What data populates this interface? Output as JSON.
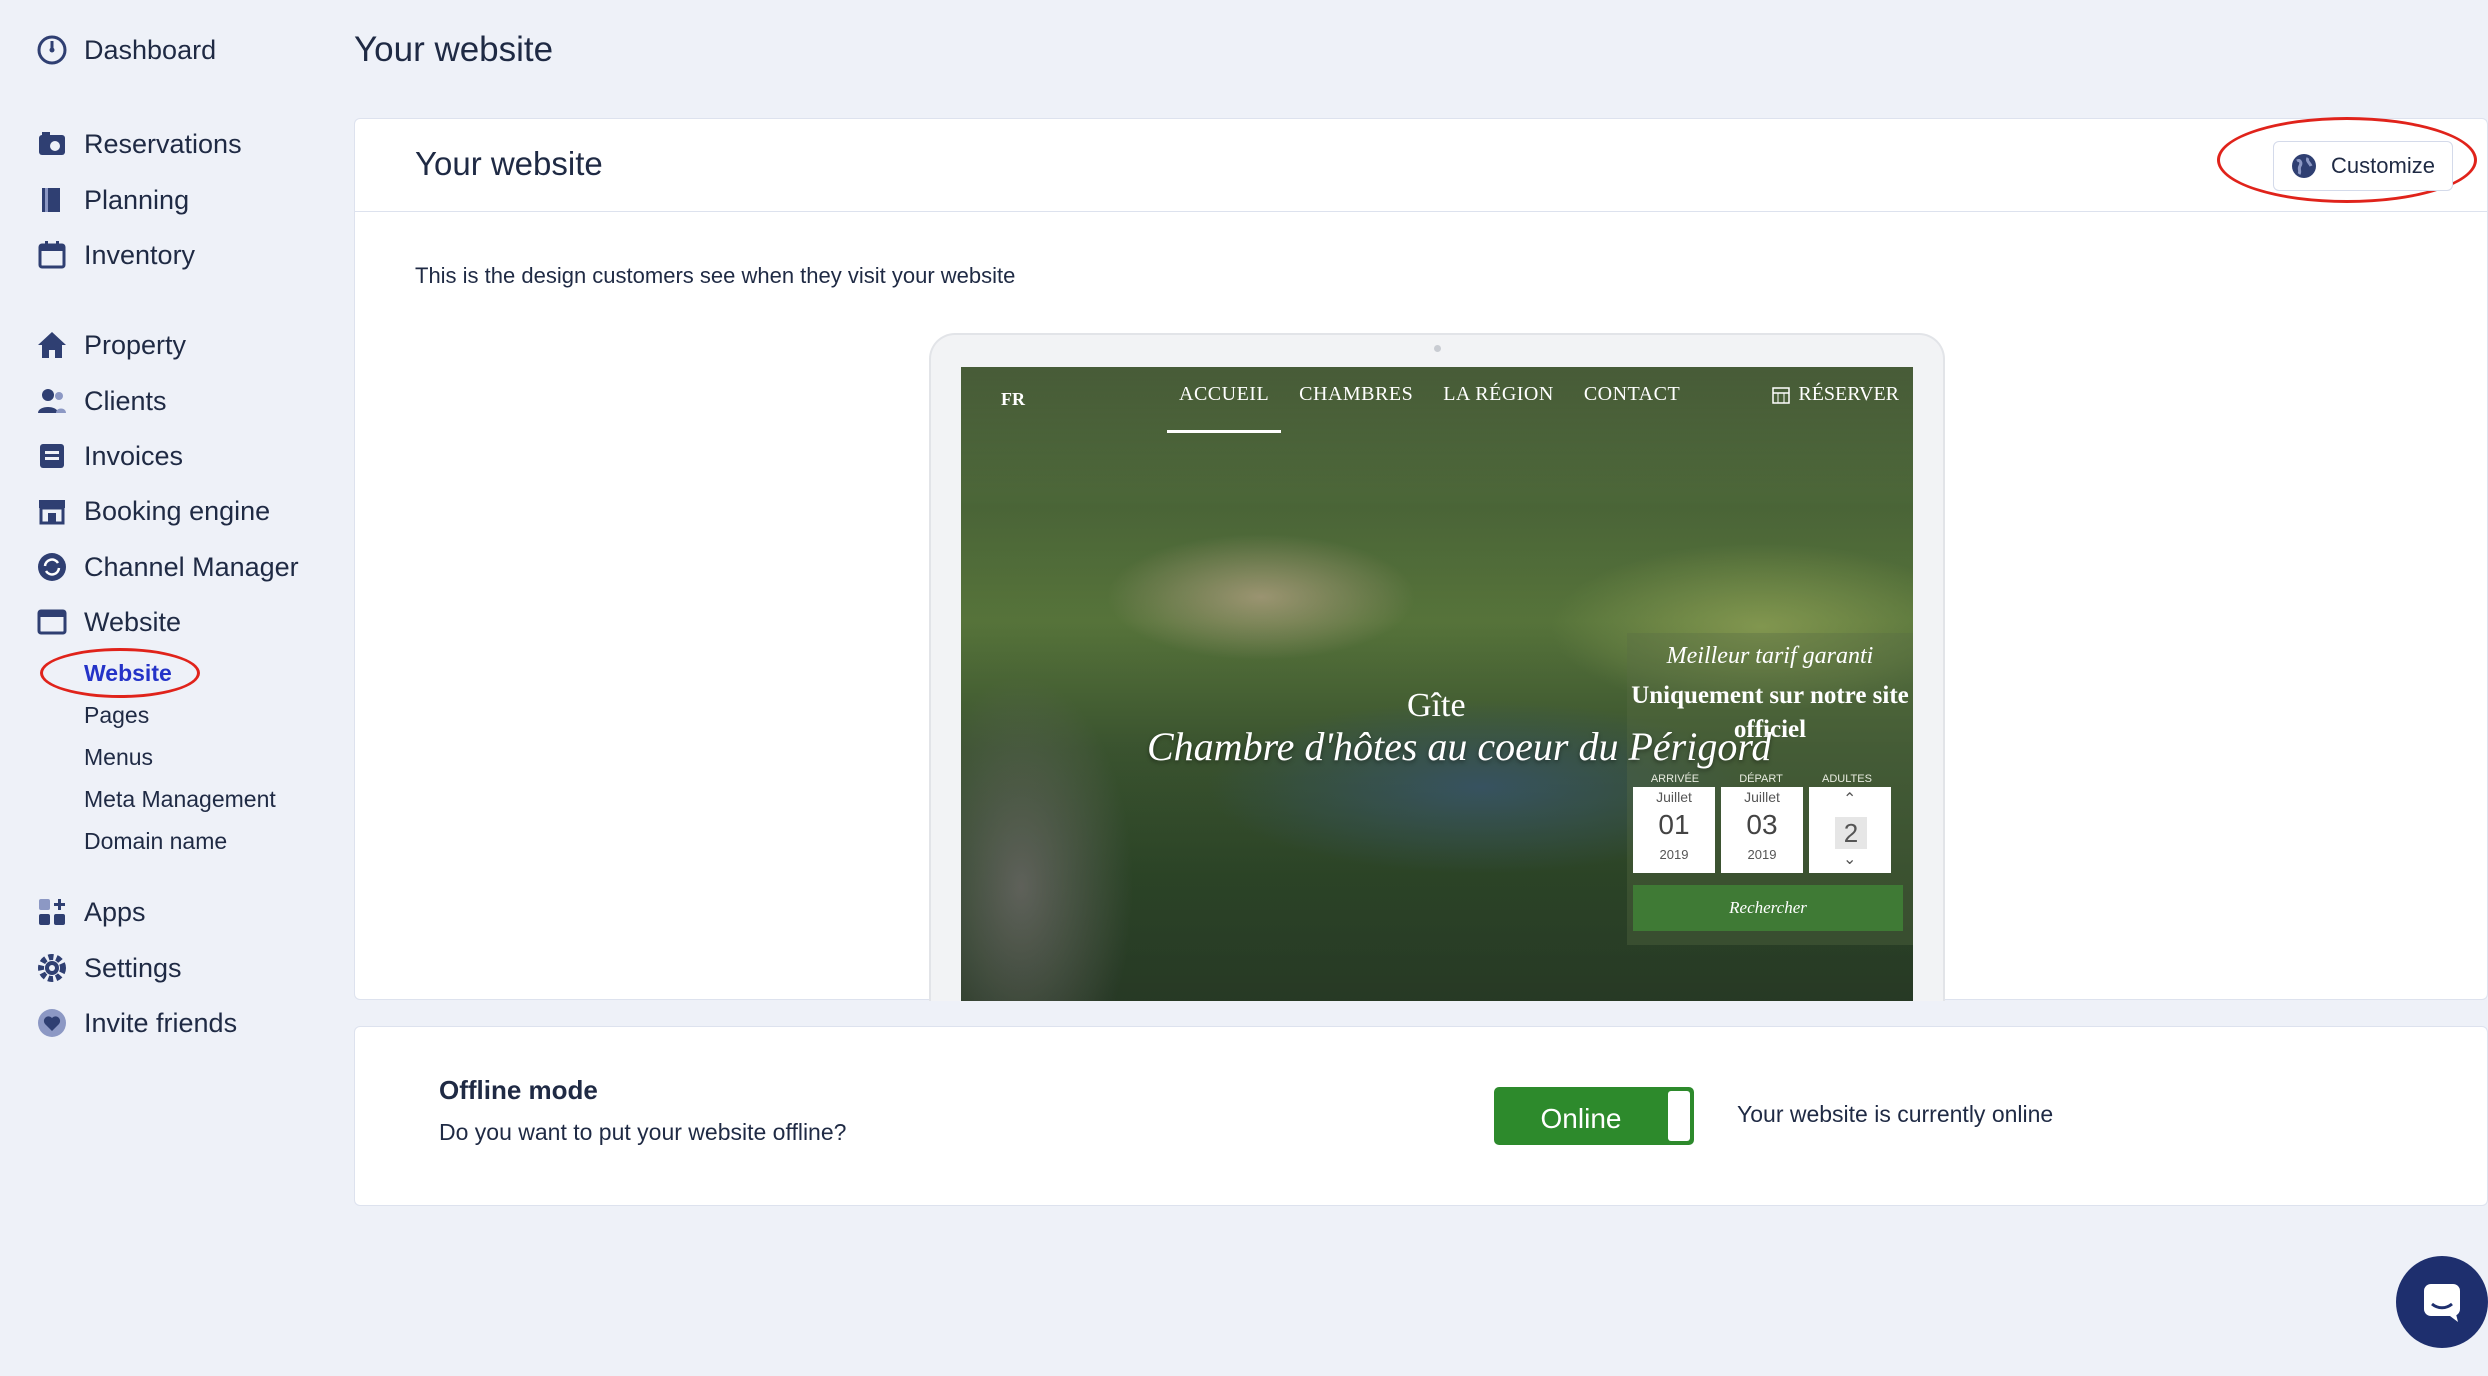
{
  "colors": {
    "background": "#eef1f8",
    "text": "#1f2a44",
    "sidebar_icon": "#2f3f72",
    "active_link": "#2433c8",
    "annotation_ring": "#e0231b",
    "toggle_online": "#2d8a2c",
    "chat_button": "#1e2f6e"
  },
  "sidebar": {
    "items": [
      {
        "label": "Dashboard",
        "icon": "speedometer-icon"
      },
      {
        "label": "Reservations",
        "icon": "calendar-camera-icon"
      },
      {
        "label": "Planning",
        "icon": "book-icon"
      },
      {
        "label": "Inventory",
        "icon": "calendar-icon"
      },
      {
        "label": "Property",
        "icon": "home-icon"
      },
      {
        "label": "Clients",
        "icon": "users-icon"
      },
      {
        "label": "Invoices",
        "icon": "invoice-icon"
      },
      {
        "label": "Booking engine",
        "icon": "storefront-icon"
      },
      {
        "label": "Channel Manager",
        "icon": "sync-icon"
      },
      {
        "label": "Website",
        "icon": "browser-window-icon"
      },
      {
        "label": "Apps",
        "icon": "apps-grid-icon"
      },
      {
        "label": "Settings",
        "icon": "gear-icon"
      },
      {
        "label": "Invite friends",
        "icon": "heart-icon"
      }
    ],
    "website_sub": [
      "Website",
      "Pages",
      "Menus",
      "Meta Management",
      "Domain name"
    ]
  },
  "page": {
    "title": "Your website"
  },
  "website_card": {
    "title": "Your website",
    "customize_label": "Customize",
    "description": "This is the design customers see when they visit your website"
  },
  "preview": {
    "lang": "FR",
    "nav": [
      "ACCUEIL",
      "CHAMBRES",
      "LA RÉGION",
      "CONTACT"
    ],
    "reserve": "RÉSERVER",
    "hero_sub": "Gîte",
    "hero_title": "Chambre d'hôtes au coeur du Périgord",
    "booking": {
      "tagline": "Meilleur tarif garanti",
      "headline": "Uniquement sur notre site officiel",
      "arrival_label": "ARRIVÉE",
      "departure_label": "DÉPART",
      "adults_label": "ADULTES",
      "arrival": {
        "month": "Juillet",
        "day": "01",
        "year": "2019"
      },
      "departure": {
        "month": "Juillet",
        "day": "03",
        "year": "2019"
      },
      "adults": "2",
      "search": "Rechercher"
    }
  },
  "offline_card": {
    "title": "Offline mode",
    "question": "Do you want to put your website offline?",
    "toggle_label": "Online",
    "status": "Your website is currently online"
  }
}
